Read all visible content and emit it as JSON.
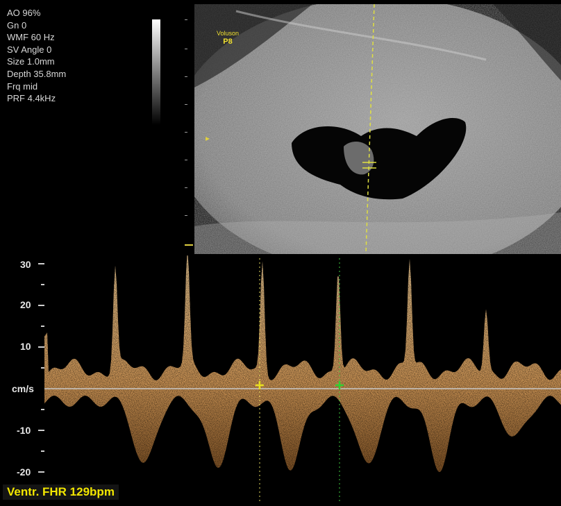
{
  "params": {
    "ao": "AO 96%",
    "gn": "Gn  0",
    "wmf": "WMF 60 Hz",
    "sv_angle": "SV Angle  0",
    "size": "Size  1.0mm",
    "depth": "Depth 35.8mm",
    "frq": "Frq mid",
    "prf": "PRF  4.4kHz"
  },
  "brand": {
    "line1": "Voluson",
    "line2": "P8"
  },
  "spectral_axis": {
    "unit": "cm/s",
    "labels": [
      "30",
      "20",
      "10",
      "-10",
      "-20"
    ]
  },
  "readout": {
    "text": "Ventr. FHR 129bpm"
  },
  "colors": {
    "doppler": "#f0c080",
    "caliper_yellow": "#e8e020",
    "caliper_green": "#30d030",
    "cursor_line": "#e0e040"
  }
}
